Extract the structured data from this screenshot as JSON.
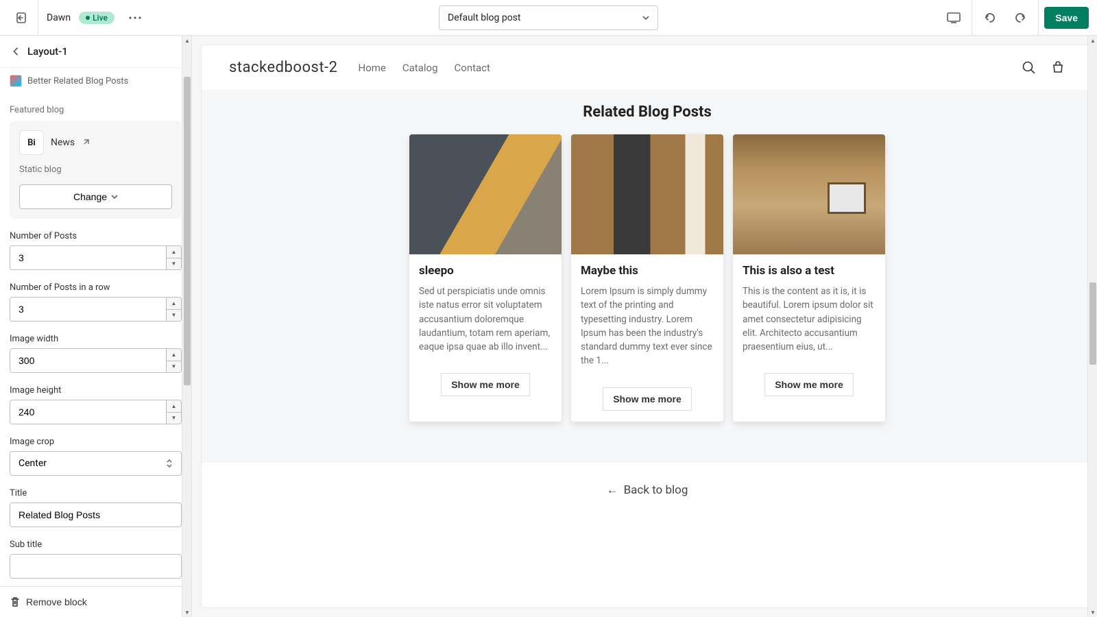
{
  "topbar": {
    "theme_name": "Dawn",
    "live_label": "Live",
    "template_label": "Default blog post",
    "save_label": "Save"
  },
  "sidebar": {
    "header_title": "Layout-1",
    "app_name": "Better Related Blog Posts",
    "featured_blog_label": "Featured blog",
    "blog_name": "News",
    "blog_sub": "Static blog",
    "change_label": "Change",
    "fields": {
      "num_posts_label": "Number of Posts",
      "num_posts_value": "3",
      "num_row_label": "Number of Posts in a row",
      "num_row_value": "3",
      "img_width_label": "Image width",
      "img_width_value": "300",
      "img_height_label": "Image height",
      "img_height_value": "240",
      "img_crop_label": "Image crop",
      "img_crop_value": "Center",
      "title_label": "Title",
      "title_value": "Related Blog Posts",
      "subtitle_label": "Sub title",
      "subtitle_value": ""
    },
    "remove_label": "Remove block"
  },
  "preview": {
    "store_name": "stackedboost-2",
    "nav": [
      "Home",
      "Catalog",
      "Contact"
    ],
    "related_title": "Related Blog Posts",
    "posts": [
      {
        "title": "sleepo",
        "excerpt": "Sed ut perspiciatis unde omnis iste natus error sit voluptatem accusantium doloremque laudantium, totam rem aperiam, eaque ipsa quae ab illo invent...",
        "cta": "Show me more"
      },
      {
        "title": "Maybe this",
        "excerpt": "Lorem Ipsum is simply dummy text of the printing and typesetting industry. Lorem Ipsum has been the industry's standard dummy text ever since the 1...",
        "cta": "Show me more"
      },
      {
        "title": "This is also a test",
        "excerpt": "This is the content as it is, it is beautiful. Lorem ipsum dolor sit amet consectetur adipisicing elit. Architecto accusantium praesentium eius, ut...",
        "cta": "Show me more"
      }
    ],
    "back_label": "Back to blog"
  }
}
